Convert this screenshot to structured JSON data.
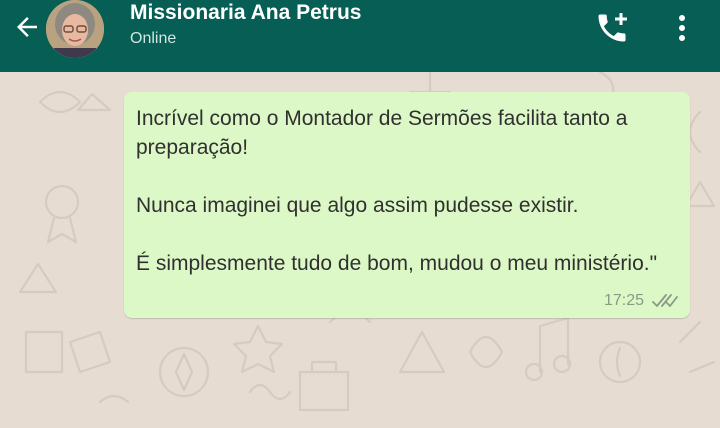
{
  "header": {
    "contact_name": "Missionaria Ana Petrus",
    "status": "Online",
    "back_icon": "arrow-left-icon",
    "call_icon": "add-call-icon",
    "menu_icon": "more-vertical-icon"
  },
  "message": {
    "paragraphs": [
      "Incrível como o Montador de Sermões facilita tanto a preparação!",
      "Nunca imaginei que algo assim pudesse existir.",
      "É simplesmente tudo de bom, mudou o meu ministério.\""
    ],
    "time": "17:25",
    "status_icon": "double-check-icon"
  },
  "colors": {
    "header_bg": "#075e54",
    "bubble_bg": "#dcf8c6",
    "wallpaper": "#e6dcd2"
  }
}
